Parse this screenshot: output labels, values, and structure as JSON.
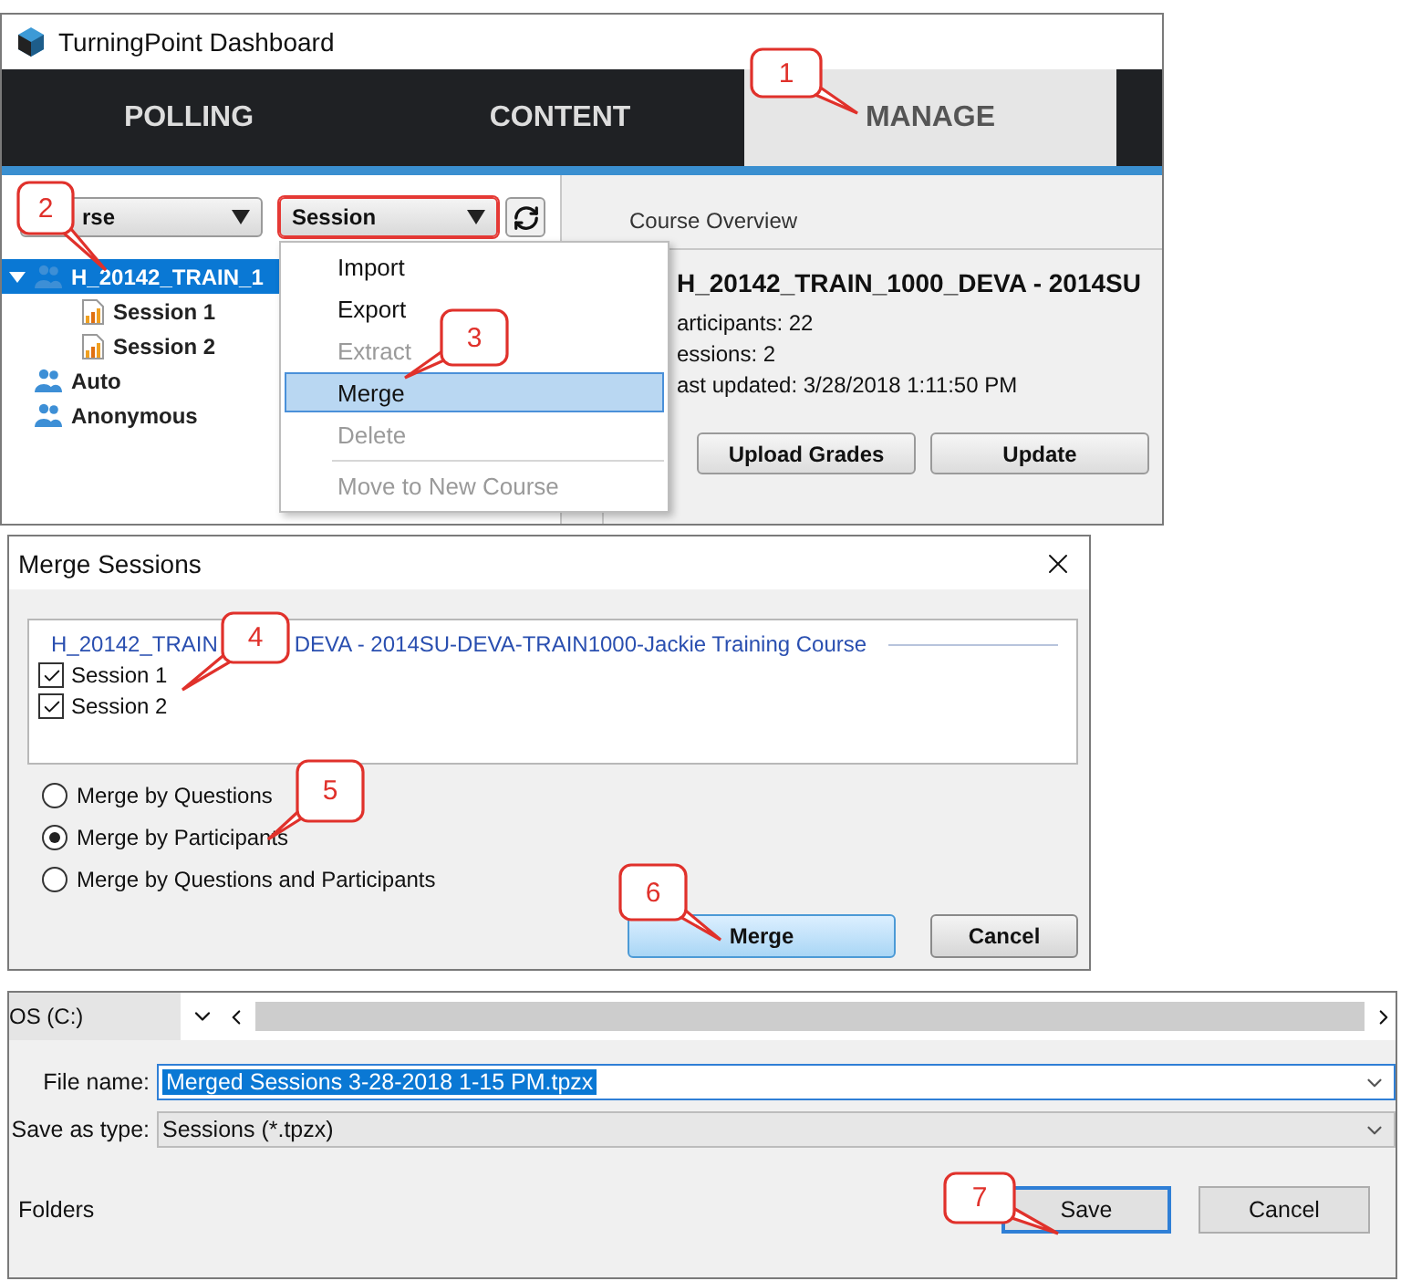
{
  "dashboard": {
    "title": "TurningPoint Dashboard",
    "tabs": [
      {
        "label": "POLLING",
        "selected": false
      },
      {
        "label": "CONTENT",
        "selected": false
      },
      {
        "label": "MANAGE",
        "selected": true
      }
    ],
    "course_dropdown": {
      "value": "rse"
    },
    "session_dropdown": {
      "value": "Session"
    },
    "tree": [
      {
        "label": "H_20142_TRAIN_1",
        "kind": "course",
        "selected": true,
        "expanded": true,
        "children": [
          {
            "label": "Session 1",
            "kind": "session",
            "selected": false
          },
          {
            "label": "Session 2",
            "kind": "session",
            "selected": false
          }
        ]
      },
      {
        "label": "Auto",
        "kind": "course",
        "selected": false
      },
      {
        "label": "Anonymous",
        "kind": "course",
        "selected": false
      }
    ],
    "menu": [
      {
        "label": "Import",
        "disabled": false,
        "selected": false,
        "divider_before": false
      },
      {
        "label": "Export",
        "disabled": false,
        "selected": false,
        "divider_before": false
      },
      {
        "label": "Extract",
        "disabled": true,
        "selected": false,
        "divider_before": false
      },
      {
        "label": "Merge",
        "disabled": false,
        "selected": true,
        "divider_before": false
      },
      {
        "label": "Delete",
        "disabled": true,
        "selected": false,
        "divider_before": false
      },
      {
        "label": "Move to New Course",
        "disabled": true,
        "selected": false,
        "divider_before": true
      }
    ],
    "overview": {
      "heading": "Course Overview",
      "course": "H_20142_TRAIN_1000_DEVA - 2014SU",
      "lines": [
        "articipants: 22",
        "essions: 2",
        "ast updated: 3/28/2018 1:11:50 PM"
      ],
      "buttons": [
        "Upload Grades",
        "Update"
      ]
    }
  },
  "merge_dialog": {
    "title": "Merge Sessions",
    "group_title": [
      "H_20142_TRAIN",
      "DEVA - 2014SU-DEVA-TRAIN1000-Jackie Training Course"
    ],
    "sessions": [
      {
        "label": "Session 1",
        "checked": true
      },
      {
        "label": "Session 2",
        "checked": true
      }
    ],
    "options": [
      {
        "label": "Merge by Questions",
        "selected": false
      },
      {
        "label": "Merge by Participants",
        "selected": true
      },
      {
        "label": "Merge by Questions and Participants",
        "selected": false
      }
    ],
    "buttons": [
      {
        "label": "Merge",
        "kind": "default"
      },
      {
        "label": "Cancel",
        "kind": "normal"
      }
    ]
  },
  "save_dialog": {
    "drive": "OS (C:)",
    "file_name_label": "File name:",
    "file_name": "Merged Sessions 3-28-2018 1-15 PM.tpzx",
    "type_label": "Save as type:",
    "type": "Sessions (*.tpzx)",
    "folders": "Folders",
    "buttons": [
      {
        "label": "Save",
        "kind": "default"
      },
      {
        "label": "Cancel",
        "kind": "normal"
      }
    ]
  },
  "callouts": [
    {
      "label": "1"
    },
    {
      "label": "2"
    },
    {
      "label": "3"
    },
    {
      "label": "4"
    },
    {
      "label": "5"
    },
    {
      "label": "6"
    },
    {
      "label": "7"
    }
  ]
}
